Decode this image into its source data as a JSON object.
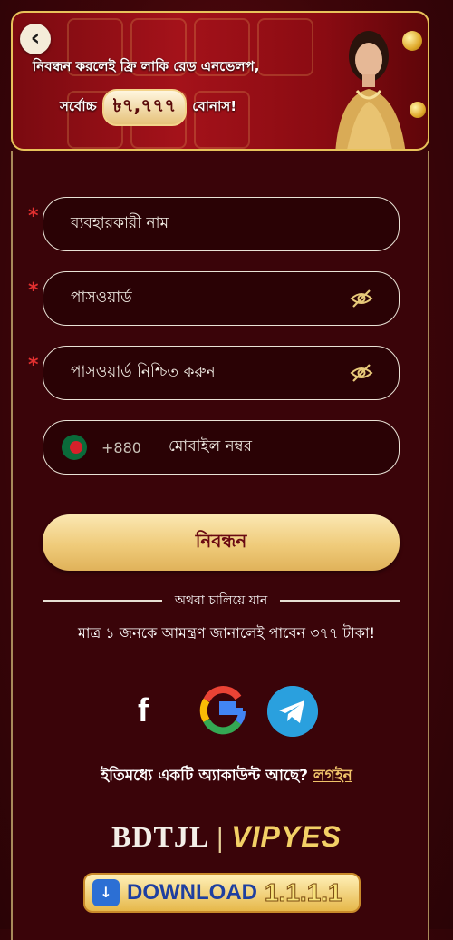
{
  "banner": {
    "promo_line1": "নিবন্ধন করলেই ফ্রি লাকি রেড এনভেলপ,",
    "promo_prefix": "সর্বোচ্চ",
    "promo_amount": "৳৭,৭৭৭",
    "promo_suffix": "বোনাস!"
  },
  "form": {
    "username_placeholder": "ব্যবহারকারী নাম",
    "password_placeholder": "পাসওয়ার্ড",
    "confirm_password_placeholder": "পাসওয়ার্ড নিশ্চিত করুন",
    "country_code": "+880",
    "mobile_placeholder": "মোবাইল নম্বর",
    "required_mark": "*",
    "submit_label": "নিবন্ধন"
  },
  "divider_text": "অথবা চালিয়ে যান",
  "invite_text": "মাত্র ১ জনকে আমন্ত্রণ জানালেই পাবেন ৩৭৭ টাকা!",
  "social": {
    "facebook_glyph": "f",
    "icons": [
      "facebook-icon",
      "google-icon",
      "telegram-icon"
    ]
  },
  "login_prompt": {
    "text": "ইতিমধ্যে একটি অ্যাকাউন্ট আছে?",
    "link": "লগইন"
  },
  "brand": {
    "left": "BDTJL",
    "separator": "|",
    "right": "VIPYES"
  },
  "download": {
    "label": "DOWNLOAD",
    "version": "1.1.1.1"
  },
  "colors": {
    "background": "#3a0409",
    "accent_gold": "#efcb7a",
    "required_red": "#e23030",
    "link_gold": "#f0c36a",
    "telegram_blue": "#2aa0de"
  }
}
